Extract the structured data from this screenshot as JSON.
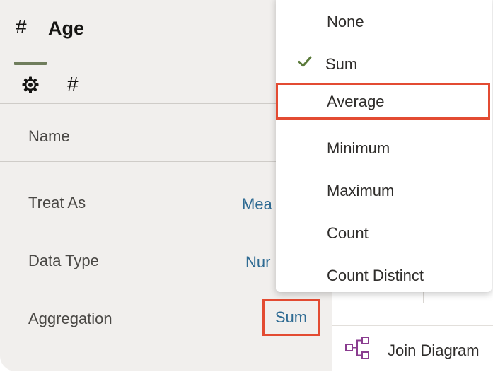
{
  "header": {
    "title": "Age",
    "hash_symbol": "#"
  },
  "tabs": {
    "active_tab_icon": "gear-icon",
    "second_tab_symbol": "#"
  },
  "properties": [
    {
      "label": "Name",
      "value": ""
    },
    {
      "label": "Treat As",
      "value": "Mea"
    },
    {
      "label": "Data Type",
      "value": "Nur"
    },
    {
      "label": "Aggregation",
      "value": "Sum"
    }
  ],
  "aggregation_menu": {
    "items": [
      {
        "label": "None",
        "selected": false
      },
      {
        "label": "Sum",
        "selected": true
      },
      {
        "label": "Average",
        "selected": false,
        "highlighted": true
      },
      {
        "label": "Minimum",
        "selected": false
      },
      {
        "label": "Maximum",
        "selected": false
      },
      {
        "label": "Count",
        "selected": false
      },
      {
        "label": "Count Distinct",
        "selected": false
      }
    ]
  },
  "background": {
    "join_diagram_label": "Join Diagram",
    "join_icon": "join-diagram-icon"
  },
  "colors": {
    "accent_link": "#2f6b93",
    "highlight_border": "#e34b32",
    "check_green": "#5a7a3a",
    "tab_underline": "#6f7d5c"
  }
}
